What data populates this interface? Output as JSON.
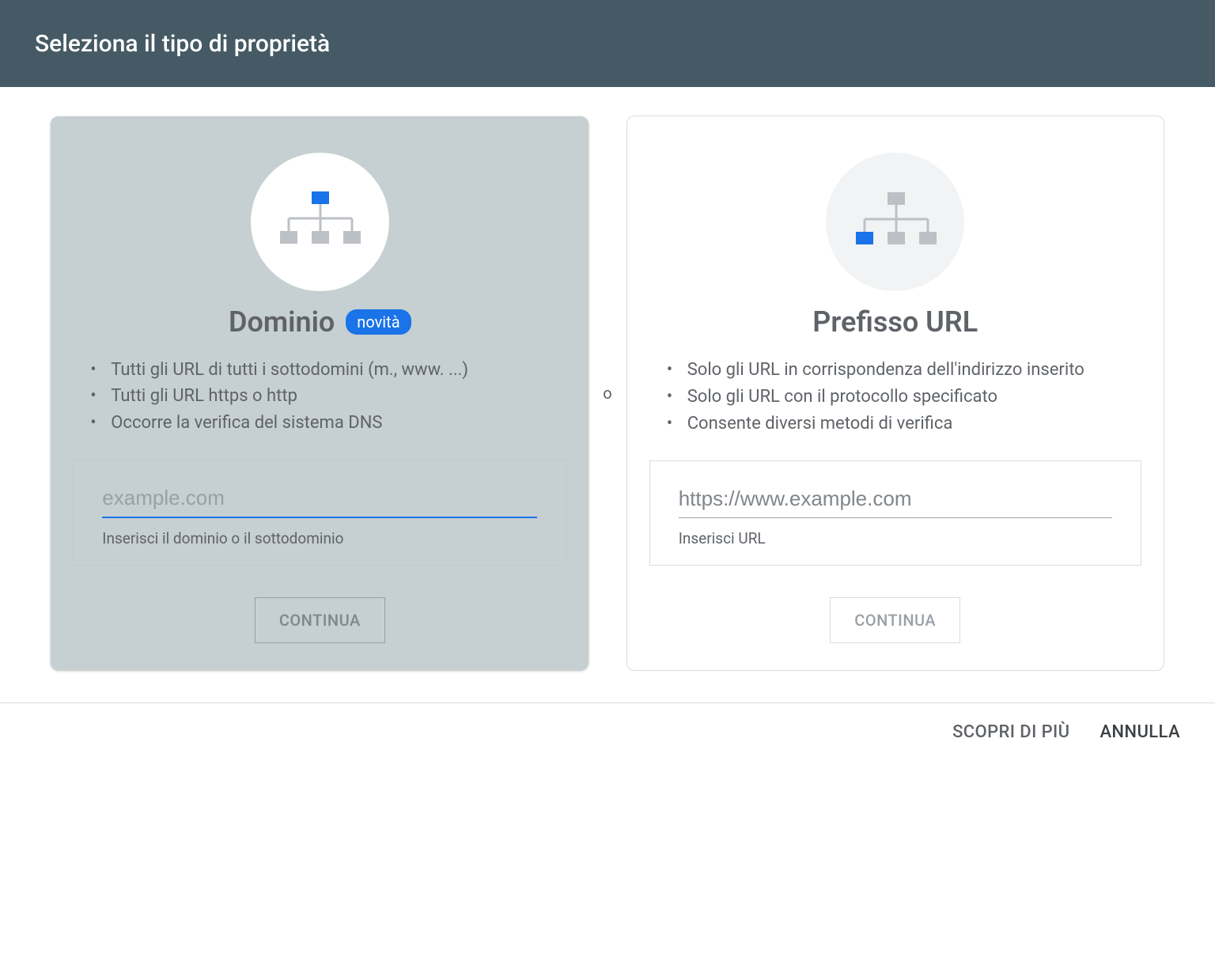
{
  "header": {
    "title": "Seleziona il tipo di proprietà"
  },
  "separator": "o",
  "domain_card": {
    "title": "Dominio",
    "badge": "novità",
    "bullets": [
      "Tutti gli URL di tutti i sottodomini (m., www. ...)",
      "Tutti gli URL https o http",
      "Occorre la verifica del sistema DNS"
    ],
    "input_placeholder": "example.com",
    "input_helper": "Inserisci il dominio o il sottodominio",
    "continue": "CONTINUA"
  },
  "url_card": {
    "title": "Prefisso URL",
    "bullets": [
      "Solo gli URL in corrispondenza dell'indirizzo inserito",
      "Solo gli URL con il protocollo specificato",
      "Consente diversi metodi di verifica"
    ],
    "input_placeholder": "https://www.example.com",
    "input_helper": "Inserisci URL",
    "continue": "CONTINUA"
  },
  "footer": {
    "learn_more": "SCOPRI DI PIÙ",
    "cancel": "ANNULLA"
  },
  "colors": {
    "accent": "#1a73e8"
  }
}
